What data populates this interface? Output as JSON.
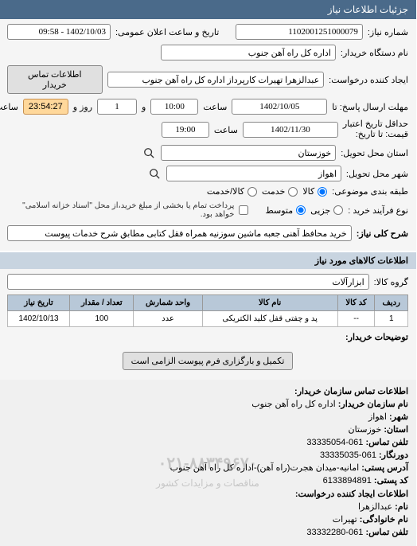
{
  "header": {
    "title": "جزئیات اطلاعات نیاز"
  },
  "form": {
    "need_number_label": "شماره نیاز:",
    "need_number": "1102001251000079",
    "public_datetime_label": "تاریخ و ساعت اعلان عمومی:",
    "public_datetime": "1402/10/03 - 09:58",
    "buyer_name_label": "نام دستگاه خریدار:",
    "buyer_name": "اداره کل راه آهن جنوب",
    "request_creator_label": "ایجاد کننده درخواست:",
    "request_creator": "عبدالزهرا تهیرات کارپرداز اداره کل راه آهن جنوب",
    "buyer_contact_btn": "اطلاعات تماس خریدار",
    "response_deadline_label": "مهلت ارسال پاسخ: تا",
    "response_date": "1402/10/05",
    "time_label": "ساعت",
    "response_time": "10:00",
    "days_sep": "و",
    "days_value": "1",
    "days_suffix": "روز و",
    "countdown": "23:54:27",
    "remaining_label": "ساعت باقی مانده",
    "validity_label_prefix": "حداقل تاریخ اعتبار",
    "validity_label_suffix": "قیمت: تا تاریخ:",
    "validity_date": "1402/11/30",
    "validity_time": "19:00",
    "delivery_province_label": "استان محل تحویل:",
    "delivery_province": "خوزستان",
    "delivery_city_label": "شهر محل تحویل:",
    "delivery_city": "اهواز",
    "topic_category_label": "طبقه بندی موضوعی:",
    "radio_goods": "کالا",
    "radio_service": "خدمت",
    "radio_goods_service": "کالا/خدمت",
    "process_type_label": "نوع فرآیند خرید :",
    "radio_small": "جزیی",
    "radio_medium": "متوسط",
    "payment_note": "پرداخت تمام یا بخشی از مبلغ خرید،از محل \"اسناد خزانه اسلامی\" خواهد بود.",
    "desc_label": "شرح کلی نیاز:",
    "desc_value": "خرید محافظ آهنی جعبه ماشین سوزنیه همراه فقل کتابی مطابق شرح خدمات پیوست"
  },
  "goods": {
    "section_title": "اطلاعات کالاهای مورد نیاز",
    "group_label": "گروه کالا:",
    "group_value": "ابزارآلات",
    "columns": {
      "row": "ردیف",
      "code": "کد کالا",
      "name": "نام کالا",
      "unit": "واحد شمارش",
      "qty": "تعداد / مقدار",
      "date": "تاریخ نیاز"
    },
    "rows": [
      {
        "row": "1",
        "code": "--",
        "name": "پد و چفتی قفل کلید الکتریکی",
        "unit": "عدد",
        "qty": "100",
        "date": "1402/10/13"
      }
    ],
    "buyer_notes_label": "توضیحات خریدار:",
    "upload_btn": "تکمیل و بارگزاری فرم پیوست الزامی است"
  },
  "contact": {
    "section_title": "اطلاعات تماس سازمان خریدار:",
    "org_name_label": "نام سازمان خریدار:",
    "org_name": "اداره کل راه آهن جنوب",
    "city_label": "شهر:",
    "city": "اهواز",
    "province_label": "استان:",
    "province": "خوزستان",
    "phone_label": "تلفن تماس:",
    "phone": "061-33335054",
    "fax_label": "دورنگار:",
    "fax": "061-33335035",
    "address_label": "آدرس پستی:",
    "address": "امانیه-میدان هجرت(راه آهن)-اداره کل راه آهن جنوب",
    "postal_label": "کد پستی:",
    "postal": "6133894891",
    "requester_section": "اطلاعات ایجاد کننده درخواست:",
    "name_label": "نام:",
    "name": "عبدالزهرا",
    "surname_label": "نام خانوادگی:",
    "surname": "تهیرات",
    "req_phone_label": "تلفن تماس:",
    "req_phone": "061-33332280",
    "watermark_phone": "۰۲۱-۸۸۳۴۹۶۷۰",
    "watermark_sub": "مناقصات و مزایدات کشور"
  }
}
